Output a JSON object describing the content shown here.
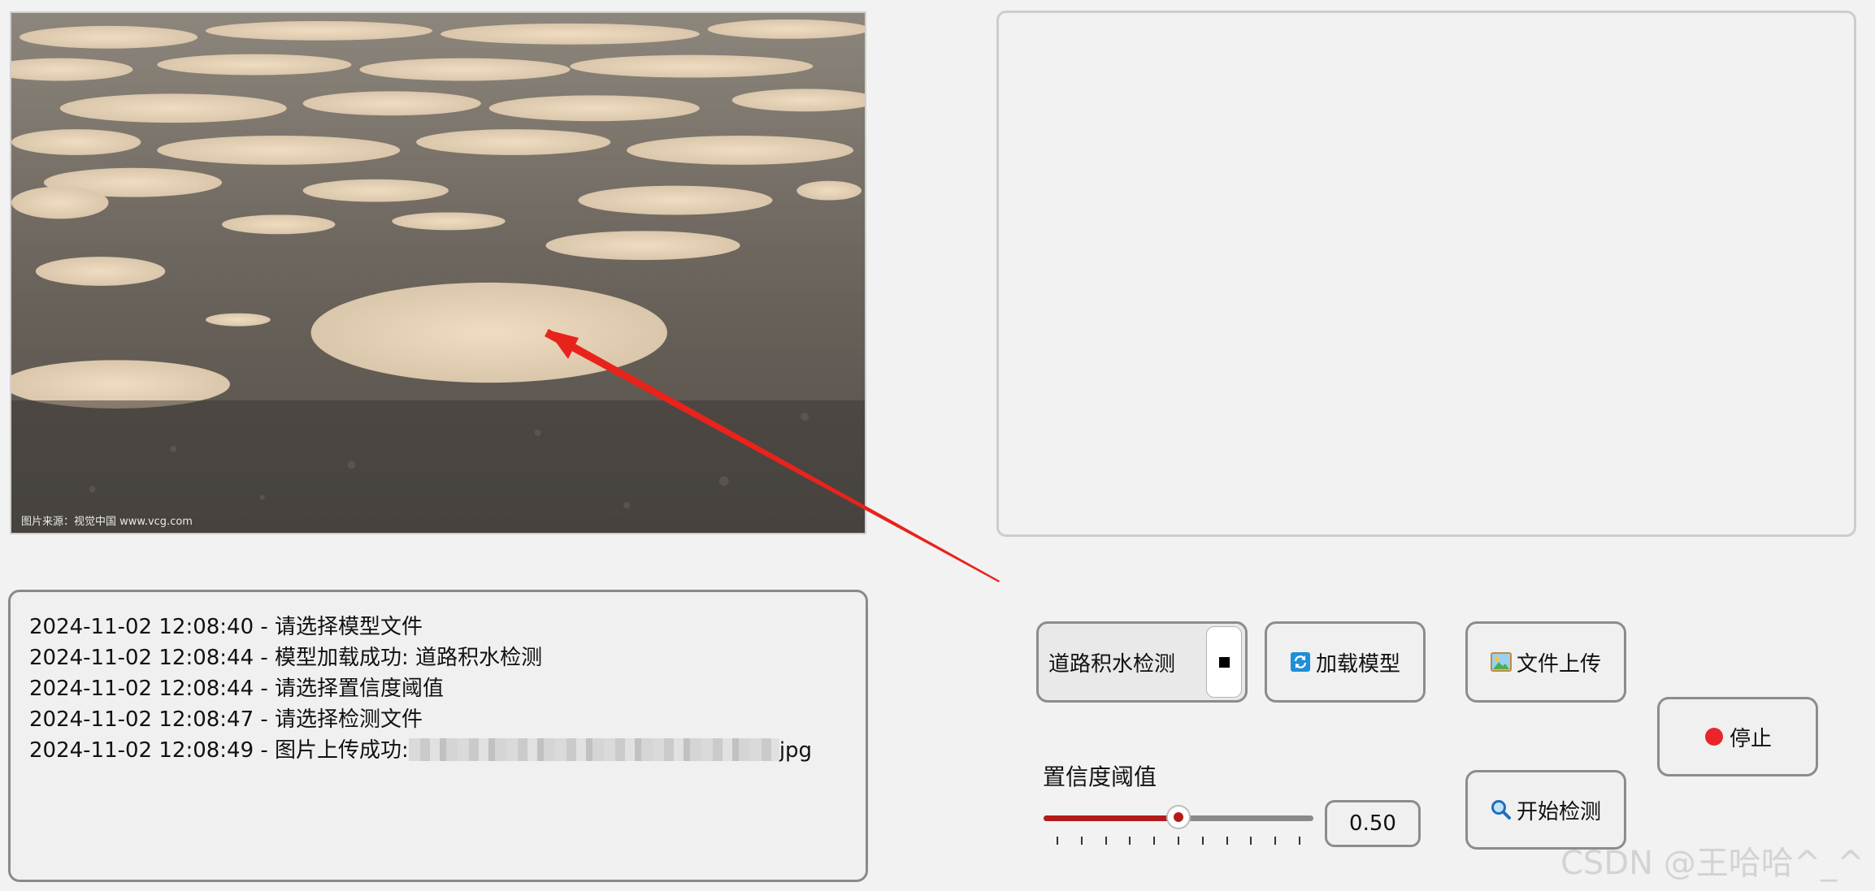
{
  "image_panel": {
    "credit": "图片来源：视觉中国 www.vcg.com"
  },
  "log": {
    "lines": [
      "2024-11-02 12:08:40 - 请选择模型文件",
      "2024-11-02 12:08:44 - 模型加载成功: 道路积水检测",
      "2024-11-02 12:08:44 - 请选择置信度阈值",
      "2024-11-02 12:08:47 - 请选择检测文件",
      "2024-11-02 12:08:49 - 图片上传成功:"
    ],
    "last_line_suffix": "jpg"
  },
  "controls": {
    "model_select_value": "道路积水检测",
    "load_model_label": "加载模型",
    "upload_label": "文件上传",
    "stop_label": "停止",
    "detect_label": "开始检测",
    "confidence_label": "置信度阈值",
    "confidence_value": "0.50",
    "confidence_level": 0.5
  },
  "icons": {
    "load_model": "refresh-icon",
    "upload": "picture-icon",
    "stop": "red-circle-icon",
    "detect": "magnifier-icon",
    "dropdown": "square-icon"
  },
  "colors": {
    "slider_fill": "#b31b1b",
    "arrow": "#e8231c",
    "stop_dot": "#e8262a",
    "refresh_bg": "#1e8fd8"
  },
  "watermark": "CSDN @王哈哈^_^"
}
